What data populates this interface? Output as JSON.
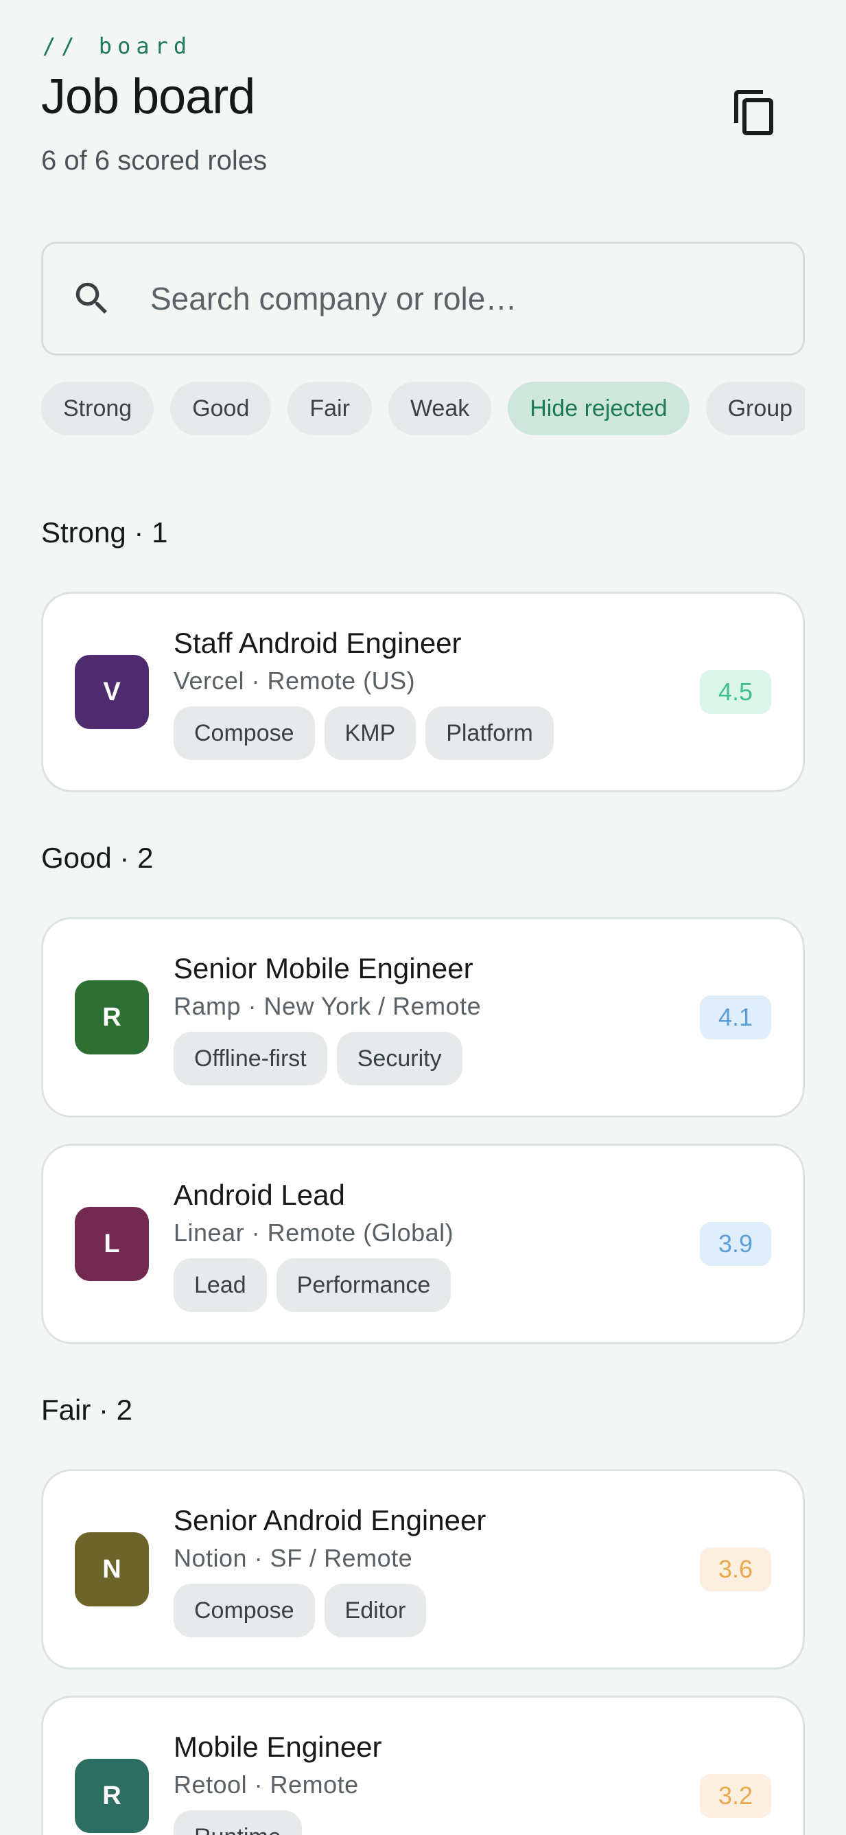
{
  "header": {
    "eyebrow": "// board",
    "title": "Job board",
    "subtitle": "6 of 6 scored roles",
    "copy_icon": "copy-icon"
  },
  "search": {
    "placeholder": "Search company or role…",
    "value": "",
    "icon": "search-icon"
  },
  "filters": [
    {
      "label": "Strong",
      "active": false
    },
    {
      "label": "Good",
      "active": false
    },
    {
      "label": "Fair",
      "active": false
    },
    {
      "label": "Weak",
      "active": false
    },
    {
      "label": "Hide rejected",
      "active": true
    },
    {
      "label": "Group",
      "active": false
    }
  ],
  "sections": [
    {
      "label": "Strong · 1",
      "jobs": [
        {
          "initial": "V",
          "avatar_color": "#4e2a6e",
          "role": "Staff Android Engineer",
          "meta": "Vercel · Remote (US)",
          "tags": [
            "Compose",
            "KMP",
            "Platform"
          ],
          "score": "4.5",
          "score_color": "#3fbf8a",
          "score_bg": "#dcf5ea"
        }
      ]
    },
    {
      "label": "Good · 2",
      "jobs": [
        {
          "initial": "R",
          "avatar_color": "#2e7034",
          "role": "Senior Mobile Engineer",
          "meta": "Ramp · New York / Remote",
          "tags": [
            "Offline-first",
            "Security"
          ],
          "score": "4.1",
          "score_color": "#5a9fd8",
          "score_bg": "#e0eefb"
        },
        {
          "initial": "L",
          "avatar_color": "#722a50",
          "role": "Android Lead",
          "meta": "Linear · Remote (Global)",
          "tags": [
            "Lead",
            "Performance"
          ],
          "score": "3.9",
          "score_color": "#5a9fd8",
          "score_bg": "#e0eefb"
        }
      ]
    },
    {
      "label": "Fair · 2",
      "jobs": [
        {
          "initial": "N",
          "avatar_color": "#6c6428",
          "role": "Senior Android Engineer",
          "meta": "Notion · SF / Remote",
          "tags": [
            "Compose",
            "Editor"
          ],
          "score": "3.6",
          "score_color": "#e8a94e",
          "score_bg": "#fcefe0"
        },
        {
          "initial": "R",
          "avatar_color": "#2c6e62",
          "role": "Mobile Engineer",
          "meta": "Retool · Remote",
          "tags": [
            "Runtime"
          ],
          "score": "3.2",
          "score_color": "#e8a94e",
          "score_bg": "#fcefe0"
        }
      ]
    }
  ]
}
